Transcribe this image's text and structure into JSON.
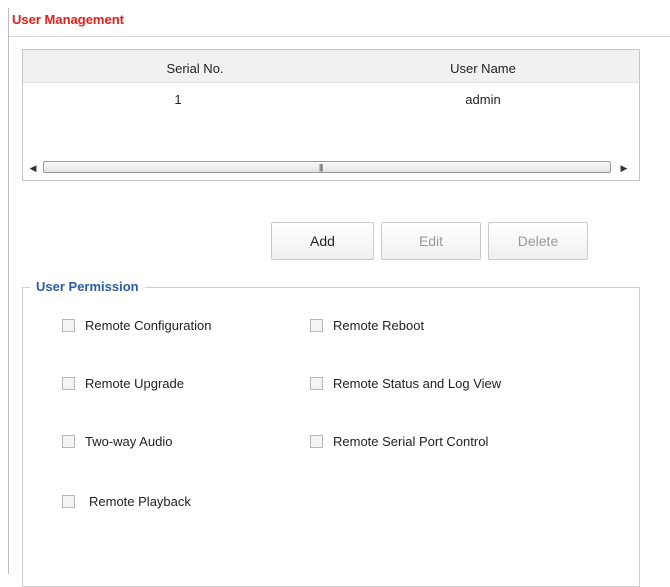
{
  "section": {
    "title": "User Management"
  },
  "user_table": {
    "columns": [
      "Serial No.",
      "User Name"
    ],
    "rows": [
      {
        "serial": "1",
        "user_name": "admin"
      }
    ]
  },
  "buttons": {
    "add": "Add",
    "edit": "Edit",
    "delete": "Delete"
  },
  "permissions": {
    "legend": "User Permission",
    "items": [
      {
        "label": "Remote Configuration",
        "checked": false
      },
      {
        "label": "Remote Reboot",
        "checked": false
      },
      {
        "label": "Remote Upgrade",
        "checked": false
      },
      {
        "label": "Remote Status and Log View",
        "checked": false
      },
      {
        "label": "Two-way Audio",
        "checked": false
      },
      {
        "label": "Remote Serial Port Control",
        "checked": false
      },
      {
        "label": "Remote Playback",
        "checked": false
      }
    ]
  },
  "colors": {
    "title": "#e0201a",
    "legend": "#2a5ea8",
    "disabled_text": "#9a9a9a"
  }
}
